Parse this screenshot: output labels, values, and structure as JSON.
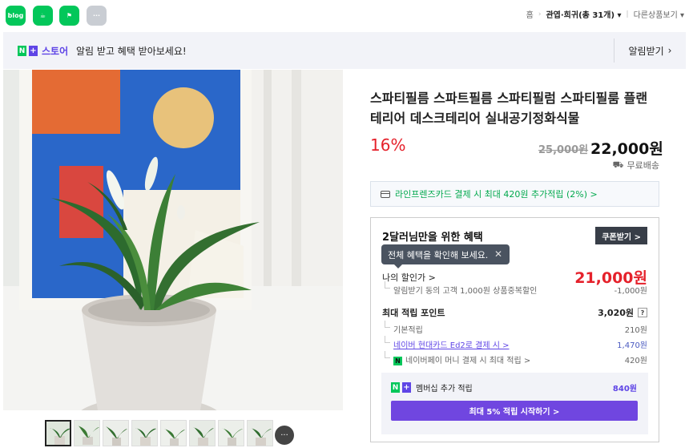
{
  "share": {
    "blog_label": "blog",
    "talk_label": "☕",
    "bookmark_label": "⚑",
    "more_label": "···"
  },
  "breadcrumb": {
    "home": "홈",
    "category": "관엽·희귀",
    "count": "(총 31개)",
    "other": "다른상품보기"
  },
  "store_bar": {
    "n_label": "N",
    "plus_label": "+",
    "store_label": "스토어",
    "message": "알림 받고 혜택 받아보세요!",
    "alarm_label": "알림받기"
  },
  "product": {
    "title": "스파티필름 스파트필름 스파티필럼 스파티필룸 플랜테리어 데스크테리어 실내공기정화식물",
    "discount": "16%",
    "original_price": "25,000원",
    "sale_price": "22,000원",
    "shipping": "무료배송",
    "card_benefit": "라인프렌즈카드 결제 시 최대 420원 추가적립 (2%) >"
  },
  "thumbnails": [
    "1",
    "2",
    "3",
    "4",
    "5",
    "6",
    "7",
    "8"
  ],
  "benefit": {
    "heading": "2달러님만을 위한 혜택",
    "coupon_button": "쿠폰받기 >",
    "tooltip": "전체 혜택을 확인해 보세요.",
    "my_price_label": "나의 할인가 >",
    "my_price": "21,000원",
    "discount_note": "알림받기 동의 고객 1,000원 상품중복할인",
    "discount_value": "-1,000원",
    "points_label": "최대 적립 포인트",
    "points_value": "3,020원",
    "basic_label": "기본적립",
    "basic_value": "210원",
    "hyundai_label": "네이버 현대카드 Ed2로 결제 시 >",
    "hyundai_value": "1,470원",
    "npay_label": "네이버페이 머니 결제 시 최대 적립 >",
    "npay_value": "420원",
    "member_label": "멤버십 추가 적립",
    "member_value": "840원",
    "member_button": "최대 5% 적립 시작하기 >"
  },
  "colors": {
    "naver_green": "#03c75a",
    "plus_purple": "#5f45e6",
    "price_red": "#e5212b",
    "member_button": "#7046e0"
  }
}
